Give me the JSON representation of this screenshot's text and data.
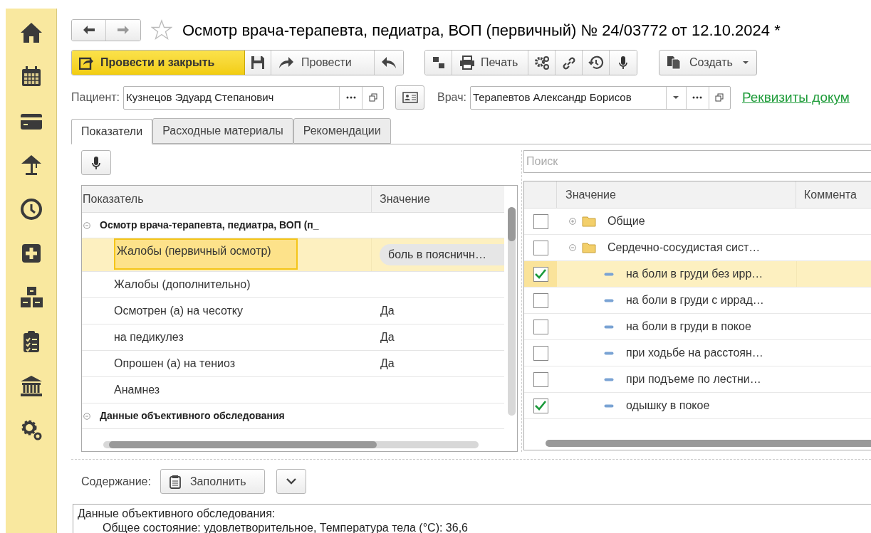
{
  "title": "Осмотр врача-терапевта, педиатра, ВОП (первичный) № 24/03772 от 12.10.2024 *",
  "toolbar": {
    "post_and_close": "Провести и закрыть",
    "post": "Провести",
    "print": "Печать",
    "create": "Создать"
  },
  "patient": {
    "label": "Пациент:",
    "value": "Кузнецов Эдуард Степанович"
  },
  "doctor": {
    "label": "Врач:",
    "value": "Терапевтов Александр Борисов"
  },
  "details_link": "Реквизиты докум",
  "tabs": [
    {
      "label": "Показатели",
      "selected": true
    },
    {
      "label": "Расходные материалы",
      "selected": false
    },
    {
      "label": "Рекомендации",
      "selected": false
    }
  ],
  "indicators": {
    "columns": [
      "Показатель",
      "Значение"
    ],
    "rows": [
      {
        "label": "Осмотр врача-терапевта, педиатра, ВОП (п_",
        "expanded": true,
        "children": [
          {
            "label": "Жалобы (первичный осмотр)",
            "value": "боль в поясничн…",
            "selected": true
          },
          {
            "label": "Жалобы (дополнительно)",
            "selected": false
          },
          {
            "label": "Осмотрен (а) на чесотку",
            "value": "Да",
            "selected": false
          },
          {
            "label": "на педикулез",
            "value": "Да",
            "selected": false
          },
          {
            "label": "Опрошен (а) на тениоз",
            "value": "Да",
            "selected": false
          },
          {
            "label": "Анамнез",
            "selected": false
          }
        ]
      },
      {
        "label": "Данные объективного обследования",
        "expanded": true,
        "children": []
      }
    ]
  },
  "values": {
    "search_placeholder": "Поиск",
    "columns": [
      "Значение",
      "Коммента"
    ],
    "rows": [
      {
        "kind": "folder",
        "label": "Общие",
        "checked": false,
        "expanded": false,
        "selected": false
      },
      {
        "kind": "folder",
        "label": "Сердечно-сосудистая сист…",
        "checked": false,
        "expanded": true,
        "selected": false,
        "children": [
          {
            "kind": "item",
            "label": "на боли в груди без ирр…",
            "checked": true,
            "selected": true
          },
          {
            "kind": "item",
            "label": "на боли в груди с иррад…",
            "checked": false,
            "selected": false
          },
          {
            "kind": "item",
            "label": "на боли в груди в покое",
            "checked": false,
            "selected": false
          },
          {
            "kind": "item",
            "label": "при ходьбе на расстоян…",
            "checked": false,
            "selected": false
          },
          {
            "kind": "item",
            "label": "при подъеме по лестни…",
            "checked": false,
            "selected": false
          },
          {
            "kind": "item",
            "label": "одышку в покое",
            "checked": true,
            "selected": false
          }
        ]
      }
    ]
  },
  "content": {
    "label": "Содержание:",
    "fill_button": "Заполнить",
    "lines": [
      {
        "text": "Данные объективного обследования:",
        "indent": false
      },
      {
        "text": "Общее состояние: удовлетворительное, Температура тела (°C): 36,6",
        "indent": true
      }
    ]
  }
}
